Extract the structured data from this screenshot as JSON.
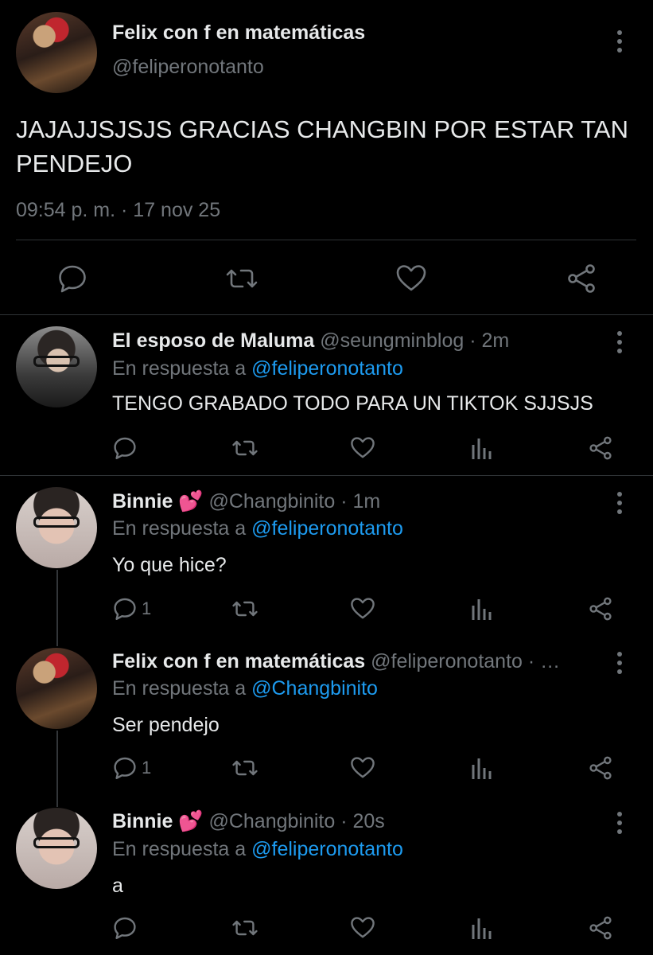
{
  "main_tweet": {
    "display_name": "Felix con f en matemáticas",
    "handle": "@feliperonotanto",
    "text": "JAJAJJSJSJS GRACIAS CHANGBIN POR ESTAR TAN PENDEJO",
    "timestamp": "09:54 p. m. · 17 nov 25",
    "actions": [
      "reply-icon",
      "retweet-icon",
      "like-icon",
      "share-icon"
    ]
  },
  "replies": [
    {
      "display_name": "El esposo de Maluma",
      "emoji": "",
      "handle_time": "@seungminblog · 2m",
      "reply_prefix": "En respuesta a",
      "reply_to": "@feliperonotanto",
      "text": "TENGO GRABADO TODO PARA UN TIKTOK SJJSJS",
      "reply_count": ""
    },
    {
      "display_name": "Binnie",
      "emoji": "💕",
      "handle_time": "@Changbinito · 1m",
      "reply_prefix": "En respuesta a",
      "reply_to": "@feliperonotanto",
      "text": "Yo que hice?",
      "reply_count": "1"
    },
    {
      "display_name": "Felix con f en matemáticas",
      "emoji": "",
      "handle_time": "@feliperonotanto · …",
      "reply_prefix": "En respuesta a",
      "reply_to": "@Changbinito",
      "text": "Ser pendejo",
      "reply_count": "1"
    },
    {
      "display_name": "Binnie",
      "emoji": "💕",
      "handle_time": "@Changbinito · 20s",
      "reply_prefix": "En respuesta a",
      "reply_to": "@feliperonotanto",
      "text": "a",
      "reply_count": ""
    }
  ],
  "colors": {
    "background": "#000000",
    "text": "#e7e9ea",
    "muted": "#71767b",
    "link": "#1d9bf0",
    "divider": "#2f3336"
  }
}
